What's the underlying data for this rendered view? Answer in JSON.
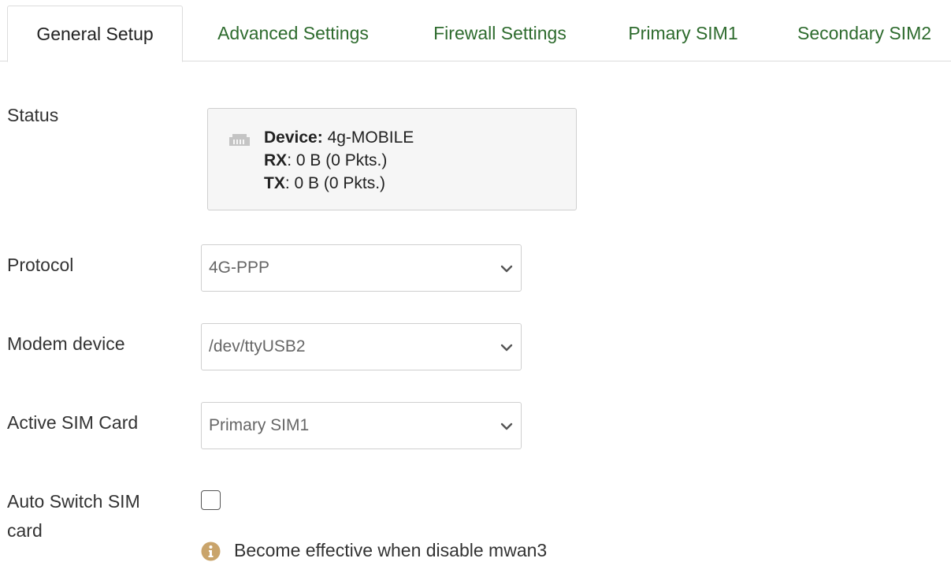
{
  "tabs": [
    {
      "label": "General Setup",
      "active": true
    },
    {
      "label": "Advanced Settings",
      "active": false
    },
    {
      "label": "Firewall Settings",
      "active": false
    },
    {
      "label": "Primary SIM1",
      "active": false
    },
    {
      "label": "Secondary SIM2",
      "active": false
    }
  ],
  "status": {
    "label": "Status",
    "device_key": "Device:",
    "device_value": "4g-MOBILE",
    "rx_key": "RX",
    "rx_value": ": 0 B (0 Pkts.)",
    "tx_key": "TX",
    "tx_value": ": 0 B (0 Pkts.)",
    "icon": "ethernet-port-icon"
  },
  "protocol": {
    "label": "Protocol",
    "value": "4G-PPP"
  },
  "modem_device": {
    "label": "Modem device",
    "value": "/dev/ttyUSB2"
  },
  "active_sim": {
    "label": "Active SIM Card",
    "value": "Primary SIM1"
  },
  "auto_switch": {
    "label": "Auto Switch SIM card",
    "checked": false,
    "hint": "Become effective when disable mwan3",
    "hint_icon": "info-icon"
  },
  "colors": {
    "tab_link": "#2e6b2e",
    "info_icon": "#c9a46b",
    "status_bg": "#f6f6f6"
  }
}
